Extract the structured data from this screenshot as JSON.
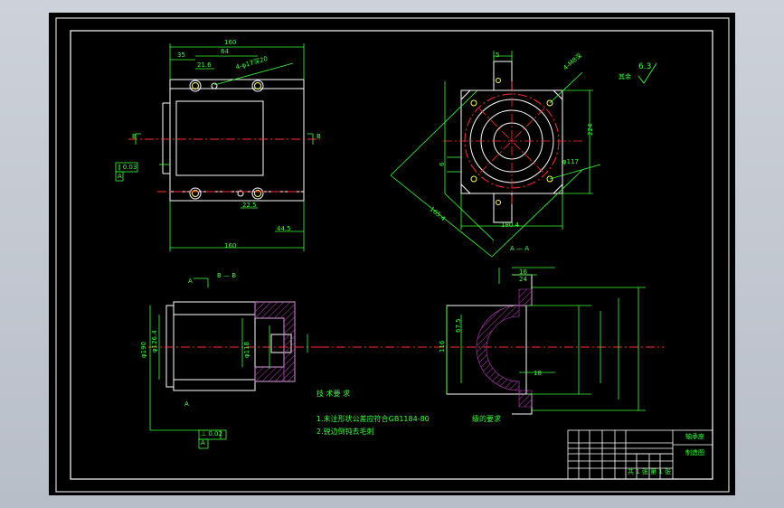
{
  "title_block": {
    "part_name": "轴承座",
    "drawing_no": "制造图",
    "scale_row": "共 1 张 第 1 张"
  },
  "notes": {
    "heading": "技 术要 求",
    "line1": "1.未注形状公差应符合GB1184-80",
    "line1_tail": "级的要求",
    "line2": "2.锐边倒钝去毛刺"
  },
  "views": {
    "section_bb": "B — B",
    "section_aa": "A — A",
    "mark_a_top": "A",
    "mark_a_bottom": "A",
    "mark_b_left": "B",
    "mark_b_right": "B"
  },
  "roughness": {
    "label": "其余",
    "value": "6.3"
  },
  "dims": {
    "top_width": "160",
    "d35": "35",
    "d64": "64",
    "d216": "21.6",
    "d225": "22.5",
    "d445": "44.5",
    "bottom_width": "160",
    "d4x17": "4-φ17深20",
    "d5": "5",
    "d1654": "165.4",
    "d1804": "180.4",
    "d224": "224",
    "d117": "φ117",
    "d4m8": "4-M8深",
    "d16": "16",
    "d24": "24",
    "d1264": "φ126.4",
    "d1164": "116",
    "d190": "φ190",
    "d118": "φ118",
    "d6": "6",
    "d675": "67.5",
    "d18": "18"
  },
  "tol_frame": {
    "a": "∥ 0.03",
    "b": "A",
    "c": "⊥ 0.02",
    "d": "A"
  }
}
